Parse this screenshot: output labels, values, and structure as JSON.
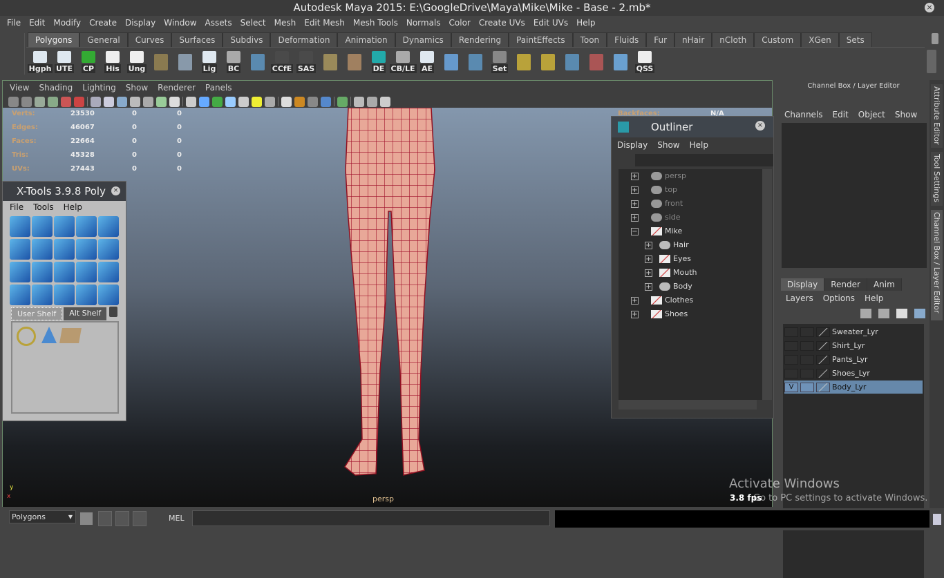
{
  "window": {
    "title": "Autodesk Maya 2015: E:\\GoogleDrive\\Maya\\Mike\\Mike - Base - 2.mb*",
    "close": "×"
  },
  "menubar": [
    "File",
    "Edit",
    "Modify",
    "Create",
    "Display",
    "Window",
    "Assets",
    "Select",
    "Mesh",
    "Edit Mesh",
    "Mesh Tools",
    "Normals",
    "Color",
    "Create UVs",
    "Edit UVs",
    "Help"
  ],
  "shelf_tabs": [
    "Polygons",
    "General",
    "Curves",
    "Surfaces",
    "Subdivs",
    "Deformation",
    "Animation",
    "Dynamics",
    "Rendering",
    "PaintEffects",
    "Toon",
    "Fluids",
    "Fur",
    "nHair",
    "nCloth",
    "Custom",
    "XGen",
    "Sets"
  ],
  "shelf_icons": [
    {
      "label": "Hgph",
      "color": "#dfe8f0"
    },
    {
      "label": "UTE",
      "color": "#dfe8f0"
    },
    {
      "label": "CP",
      "color": "#3a3"
    },
    {
      "label": "His",
      "color": "#eee"
    },
    {
      "label": "Ung",
      "color": "#eee"
    },
    {
      "label": "",
      "color": "#8a7a50"
    },
    {
      "label": "",
      "color": "#8899aa"
    },
    {
      "label": "Lig",
      "color": "#dfe8f0"
    },
    {
      "label": "BC",
      "color": "#aaa"
    },
    {
      "label": "",
      "color": "#5a8ab0"
    },
    {
      "label": "CCfE",
      "color": "#4a4a4a"
    },
    {
      "label": "SAS",
      "color": "#4a4a4a"
    },
    {
      "label": "",
      "color": "#9a8a5a"
    },
    {
      "label": "",
      "color": "#a08060"
    },
    {
      "label": "DE",
      "color": "#2aa"
    },
    {
      "label": "CB/LE",
      "color": "#aaa"
    },
    {
      "label": "AE",
      "color": "#dfe8f0"
    },
    {
      "label": "",
      "color": "#6699cc"
    },
    {
      "label": "",
      "color": "#5a8ab0"
    },
    {
      "label": "Set",
      "color": "#888"
    },
    {
      "label": "",
      "color": "#b9a23a"
    },
    {
      "label": "",
      "color": "#b9a23a"
    },
    {
      "label": "",
      "color": "#5a8ab0"
    },
    {
      "label": "",
      "color": "#a55"
    },
    {
      "label": "",
      "color": "#6aa0d0"
    },
    {
      "label": "QSS",
      "color": "#eee"
    }
  ],
  "panel": {
    "menu": [
      "View",
      "Shading",
      "Lighting",
      "Show",
      "Renderer",
      "Panels"
    ],
    "camera": "persp",
    "fps": "3.8 fps"
  },
  "hud": {
    "rows": [
      {
        "k": "Verts:",
        "v": [
          "23530",
          "0",
          "0"
        ]
      },
      {
        "k": "Edges:",
        "v": [
          "46067",
          "0",
          "0"
        ]
      },
      {
        "k": "Faces:",
        "v": [
          "22664",
          "0",
          "0"
        ]
      },
      {
        "k": "Tris:",
        "v": [
          "45328",
          "0",
          "0"
        ]
      },
      {
        "k": "UVs:",
        "v": [
          "27443",
          "0",
          "0"
        ]
      }
    ],
    "backfaces_label": "Backfaces:",
    "backfaces_value": "N/A"
  },
  "xtools": {
    "title": "X-Tools 3.9.8 Poly",
    "menu": [
      "File",
      "Tools",
      "Help"
    ],
    "tabs": [
      "User Shelf",
      "Alt Shelf"
    ]
  },
  "outliner": {
    "title": "Outliner",
    "menu": [
      "Display",
      "Show",
      "Help"
    ],
    "filter": "",
    "nodes": [
      {
        "name": "persp",
        "depth": 0,
        "exp": "+",
        "type": "camera"
      },
      {
        "name": "top",
        "depth": 0,
        "exp": "+",
        "type": "camera"
      },
      {
        "name": "front",
        "depth": 0,
        "exp": "+",
        "type": "camera"
      },
      {
        "name": "side",
        "depth": 0,
        "exp": "+",
        "type": "camera"
      },
      {
        "name": "Mike",
        "depth": 0,
        "exp": "−",
        "type": "group"
      },
      {
        "name": "Hair",
        "depth": 1,
        "exp": "+",
        "type": "mesh"
      },
      {
        "name": "Eyes",
        "depth": 1,
        "exp": "+",
        "type": "group"
      },
      {
        "name": "Mouth",
        "depth": 1,
        "exp": "+",
        "type": "group"
      },
      {
        "name": "Body",
        "depth": 1,
        "exp": "+",
        "type": "mesh"
      },
      {
        "name": "Clothes",
        "depth": 0,
        "exp": "+",
        "type": "group"
      },
      {
        "name": "Shoes",
        "depth": 0,
        "exp": "+",
        "type": "group"
      }
    ]
  },
  "channelbox": {
    "title": "Channel Box / Layer Editor",
    "menu": [
      "Channels",
      "Edit",
      "Object",
      "Show"
    ],
    "layer_tabs": [
      "Display",
      "Render",
      "Anim"
    ],
    "layer_menu": [
      "Layers",
      "Options",
      "Help"
    ],
    "layers": [
      {
        "name": "Sweater_Lyr",
        "v": "",
        "selected": false
      },
      {
        "name": "Shirt_Lyr",
        "v": "",
        "selected": false
      },
      {
        "name": "Pants_Lyr",
        "v": "",
        "selected": false
      },
      {
        "name": "Shoes_Lyr",
        "v": "",
        "selected": false
      },
      {
        "name": "Body_Lyr",
        "v": "V",
        "selected": true
      }
    ]
  },
  "side_tabs": [
    "Attribute Editor",
    "Tool Settings",
    "Channel Box / Layer Editor"
  ],
  "bottom": {
    "mode": "Polygons",
    "mel_label": "MEL",
    "mel_value": ""
  },
  "watermark": {
    "title": "Activate Windows",
    "text": "Go to PC settings to activate Windows."
  },
  "axis": {
    "x": "x",
    "y": "y"
  }
}
